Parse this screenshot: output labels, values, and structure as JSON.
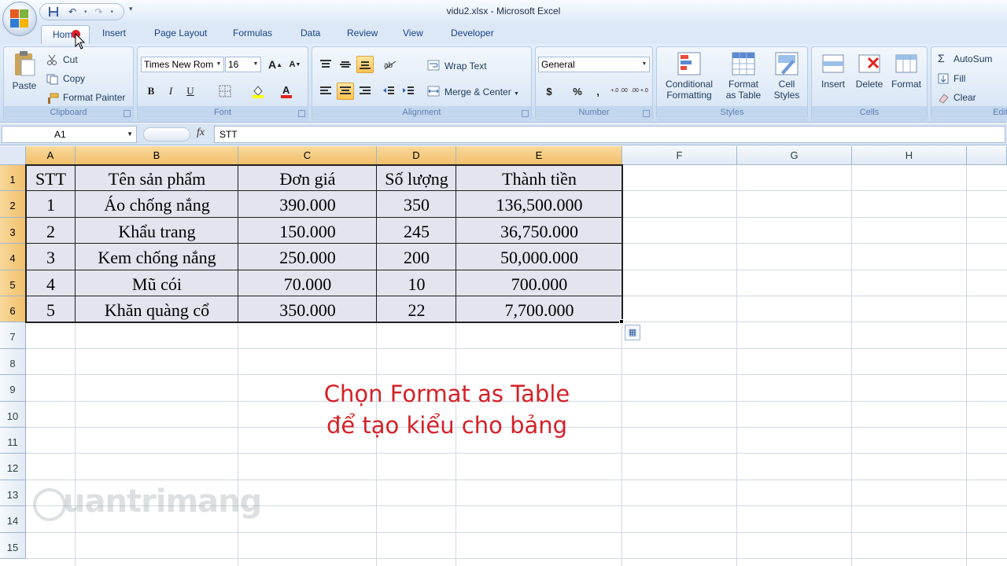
{
  "window": {
    "title": "vidu2.xlsx - Microsoft Excel"
  },
  "ribbon_tabs": [
    "Home",
    "Insert",
    "Page Layout",
    "Formulas",
    "Data",
    "Review",
    "View",
    "Developer"
  ],
  "active_tab": "Home",
  "clipboard": {
    "paste": "Paste",
    "cut": "Cut",
    "copy": "Copy",
    "format_painter": "Format Painter",
    "label": "Clipboard"
  },
  "font": {
    "name": "Times New Rom",
    "size": "16",
    "bold": "B",
    "italic": "I",
    "underline": "U",
    "grow": "A",
    "shrink": "A",
    "label": "Font"
  },
  "alignment": {
    "wrap_text": "Wrap Text",
    "merge_center": "Merge & Center",
    "label": "Alignment"
  },
  "number": {
    "format": "General",
    "currency": "$",
    "percent": "%",
    "comma": ",",
    "inc_decimal": "+.0 .00",
    "dec_decimal": ".00 +.0",
    "label": "Number"
  },
  "styles": {
    "conditional": [
      "Conditional",
      "Formatting"
    ],
    "format_table": [
      "Format",
      "as Table"
    ],
    "cell_styles": [
      "Cell",
      "Styles"
    ],
    "label": "Styles"
  },
  "cells": {
    "insert": "Insert",
    "delete": "Delete",
    "format": "Format",
    "label": "Cells"
  },
  "editing": {
    "autosum": "AutoSum",
    "fill": "Fill",
    "clear": "Clear",
    "label": "Editi"
  },
  "formula_bar": {
    "name_box": "A1",
    "fx": "fx",
    "content": "STT"
  },
  "columns": [
    "A",
    "B",
    "C",
    "D",
    "E",
    "F",
    "G",
    "H"
  ],
  "rows": [
    "1",
    "2",
    "3",
    "4",
    "5",
    "6",
    "7",
    "8",
    "9",
    "10",
    "11",
    "12",
    "13",
    "14",
    "15"
  ],
  "table": {
    "header": [
      "STT",
      "Tên sản phẩm",
      "Đơn giá",
      "Số lượng",
      "Thành tiền"
    ],
    "rows": [
      [
        "1",
        "Áo chống nắng",
        "390.000",
        "350",
        "136,500.000"
      ],
      [
        "2",
        "Khẩu trang",
        "150.000",
        "245",
        "36,750.000"
      ],
      [
        "3",
        "Kem chống nắng",
        "250.000",
        "200",
        "50,000.000"
      ],
      [
        "4",
        "Mũ cói",
        "70.000",
        "10",
        "700.000"
      ],
      [
        "5",
        "Khăn quàng cổ",
        "350.000",
        "22",
        "7,700.000"
      ]
    ]
  },
  "caption": {
    "line1": "Chọn Format as Table",
    "line2": "để tạo kiểu cho bảng"
  },
  "watermark": "uantrimang",
  "colors": {
    "caption": "#d42127",
    "header_highlight": "#f1bf6b",
    "selection_fill": "#e4e4ef"
  }
}
